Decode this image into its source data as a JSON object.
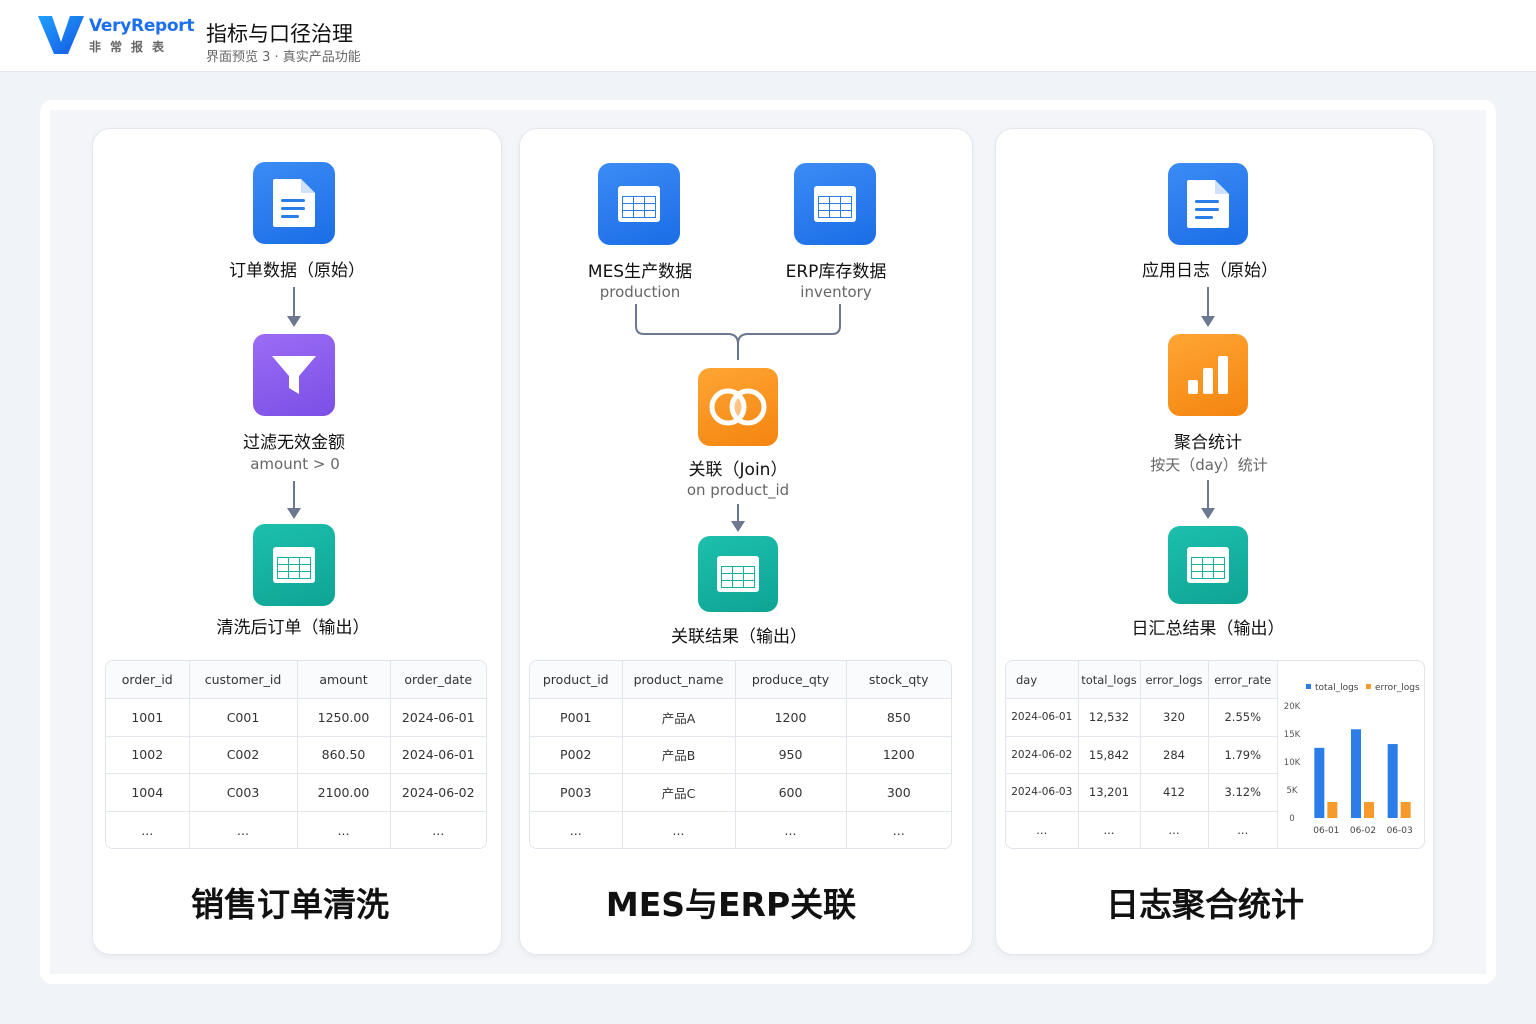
{
  "header": {
    "brand": "VeryReport",
    "brand_cn": "非常报表",
    "title": "指标与口径治理",
    "subtitle": "界面预览 3 · 真实产品功能"
  },
  "cards": [
    {
      "title": "销售订单清洗",
      "nodes": [
        {
          "label": "订单数据（原始）",
          "icon": "document-icon"
        },
        {
          "label": "过滤无效金额",
          "sub": "amount > 0",
          "icon": "filter-icon"
        },
        {
          "label": "清洗后订单（输出）",
          "icon": "table-icon"
        }
      ],
      "table": {
        "columns": [
          "order_id",
          "customer_id",
          "amount",
          "order_date"
        ],
        "rows": [
          [
            "1001",
            "C001",
            "1250.00",
            "2024-06-01"
          ],
          [
            "1002",
            "C002",
            "860.50",
            "2024-06-01"
          ],
          [
            "1004",
            "C003",
            "2100.00",
            "2024-06-02"
          ],
          [
            "...",
            "...",
            "...",
            "..."
          ]
        ]
      }
    },
    {
      "title": "MES与ERP关联",
      "nodes": [
        {
          "label": "MES生产数据",
          "sub": "production",
          "icon": "table-icon"
        },
        {
          "label": "ERP库存数据",
          "sub": "inventory",
          "icon": "table-icon"
        },
        {
          "label": "关联（Join）",
          "sub": "on product_id",
          "icon": "join-icon"
        },
        {
          "label": "关联结果（输出）",
          "icon": "table-icon"
        }
      ],
      "table": {
        "columns": [
          "product_id",
          "product_name",
          "produce_qty",
          "stock_qty"
        ],
        "rows": [
          [
            "P001",
            "产品A",
            "1200",
            "850"
          ],
          [
            "P002",
            "产品B",
            "950",
            "1200"
          ],
          [
            "P003",
            "产品C",
            "600",
            "300"
          ],
          [
            "...",
            "...",
            "...",
            "..."
          ]
        ]
      }
    },
    {
      "title": "日志聚合统计",
      "nodes": [
        {
          "label": "应用日志（原始）",
          "icon": "document-icon"
        },
        {
          "label": "聚合统计",
          "sub": "按天（day）统计",
          "icon": "bar-chart-icon"
        },
        {
          "label": "日汇总结果（输出）",
          "icon": "table-icon"
        }
      ],
      "table": {
        "columns": [
          "day",
          "total_logs",
          "error_logs",
          "error_rate"
        ],
        "rows": [
          [
            "2024-06-01",
            "12,532",
            "320",
            "2.55%"
          ],
          [
            "2024-06-02",
            "15,842",
            "284",
            "1.79%"
          ],
          [
            "2024-06-03",
            "13,201",
            "412",
            "3.12%"
          ],
          [
            "...",
            "...",
            "...",
            "..."
          ]
        ]
      }
    }
  ],
  "chart_data": {
    "type": "bar",
    "categories": [
      "06-01",
      "06-02",
      "06-03"
    ],
    "series": [
      {
        "name": "total_logs",
        "values": [
          12532,
          15842,
          13201
        ],
        "color": "#2b7de9"
      },
      {
        "name": "error_logs",
        "values": [
          320,
          284,
          412
        ],
        "color": "#f59a2b"
      }
    ],
    "yticks": [
      "0",
      "5K",
      "10K",
      "15K",
      "20K"
    ],
    "ylim": [
      0,
      20000
    ],
    "legend": "top",
    "grid": false
  },
  "colors": {
    "brand": "#1c6ef0",
    "blue": "#2b7de9",
    "orange": "#f59a2b",
    "purple": "#8b5cf6",
    "teal": "#14b0a0"
  }
}
